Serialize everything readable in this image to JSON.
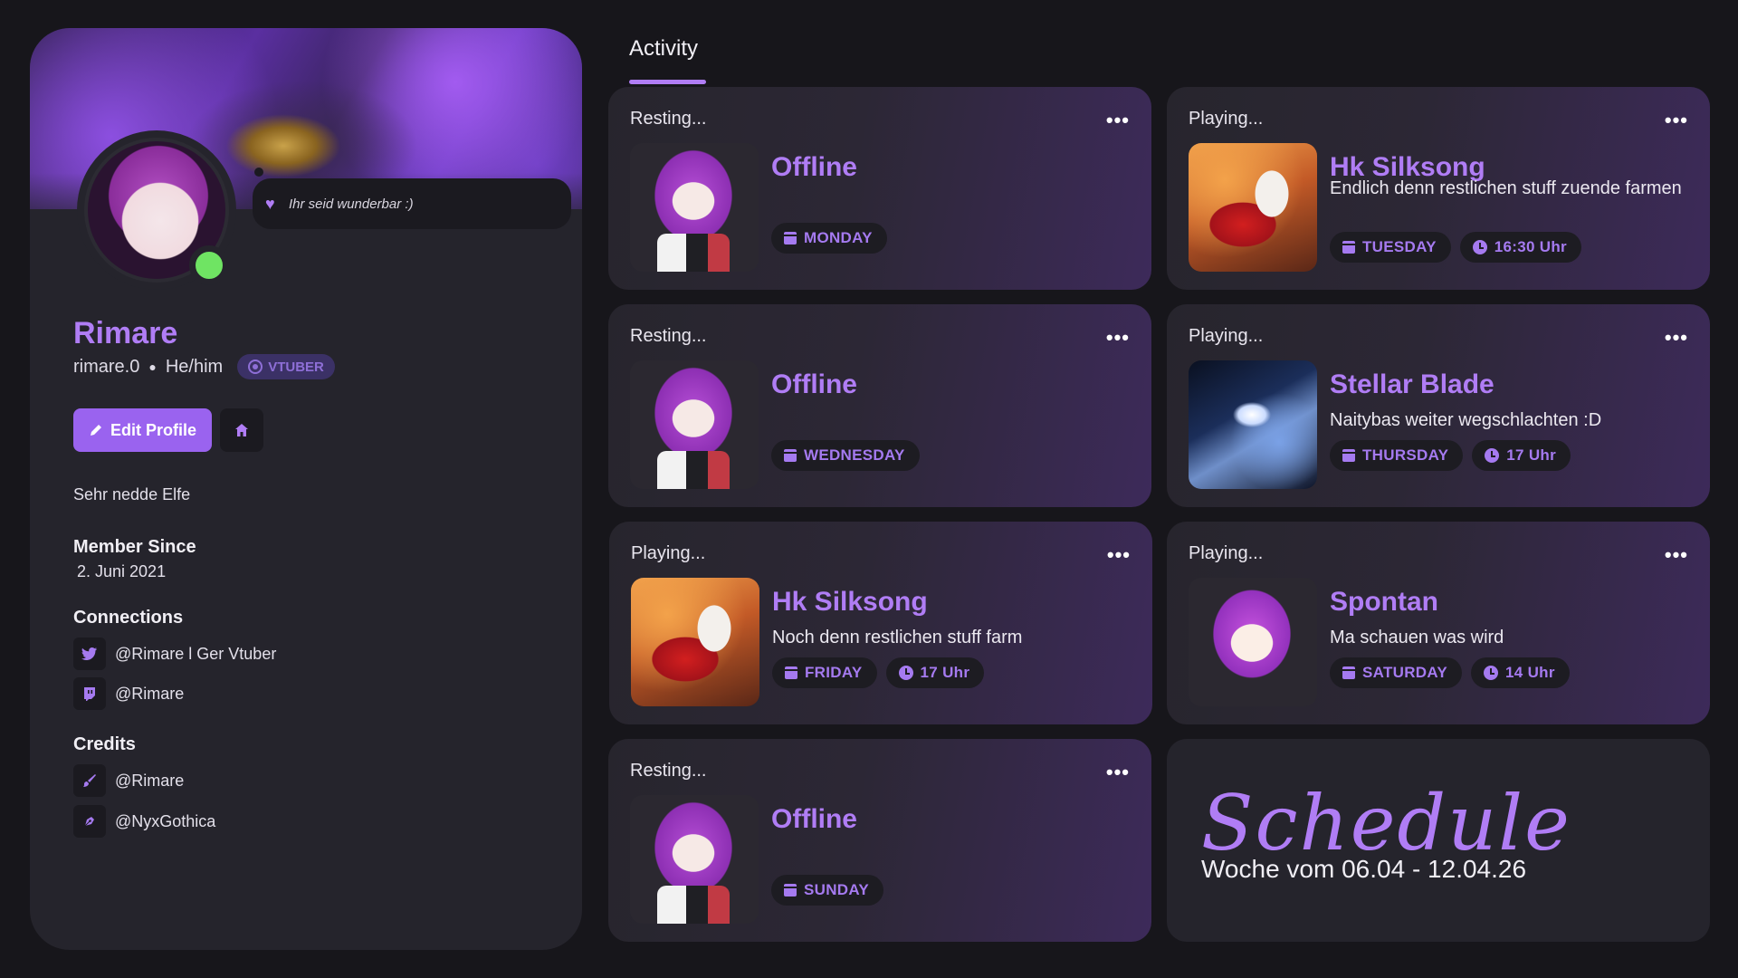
{
  "profile": {
    "status_message": "Ihr seid wunderbar :)",
    "display_name": "Rimare",
    "username": "rimare.0",
    "pronouns": "He/him",
    "badge": "VTUBER",
    "edit_label": "Edit Profile",
    "bio": "Sehr nedde Elfe",
    "member_since_title": "Member Since",
    "member_since_date": "2. Juni 2021",
    "connections_title": "Connections",
    "connections": [
      {
        "icon": "twitter-icon",
        "label": "@Rimare l Ger Vtuber"
      },
      {
        "icon": "twitch-icon",
        "label": "@Rimare"
      }
    ],
    "credits_title": "Credits",
    "credits": [
      {
        "icon": "brush-icon",
        "label": "@Rimare"
      },
      {
        "icon": "pen-icon",
        "label": "@NyxGothica"
      }
    ]
  },
  "activity_tab": "Activity",
  "cards": [
    {
      "state": "Resting...",
      "title": "Offline",
      "desc": "",
      "day": "MONDAY",
      "time": ""
    },
    {
      "state": "Playing...",
      "title": "Hk Silksong",
      "desc": "Endlich denn restlichen stuff zuende farmen",
      "day": "TUESDAY",
      "time": "16:30 Uhr"
    },
    {
      "state": "Resting...",
      "title": "Offline",
      "desc": "",
      "day": "WEDNESDAY",
      "time": ""
    },
    {
      "state": "Playing...",
      "title": "Stellar Blade",
      "desc": "Naitybas weiter wegschlachten :D",
      "day": "THURSDAY",
      "time": "17 Uhr"
    },
    {
      "state": "Playing...",
      "title": "Hk Silksong",
      "desc": "Noch denn restlichen stuff farm",
      "day": "FRIDAY",
      "time": "17 Uhr"
    },
    {
      "state": "Playing...",
      "title": "Spontan",
      "desc": "Ma schauen was wird",
      "day": "SATURDAY",
      "time": "14  Uhr"
    },
    {
      "state": "Resting...",
      "title": "Offline",
      "desc": "",
      "day": "SUNDAY",
      "time": ""
    }
  ],
  "more_label": "•••",
  "schedule": {
    "title": "Schedule",
    "subtitle": "Woche vom 06.04 - 12.04.26"
  },
  "colors": {
    "accent": "#b07df5",
    "online": "#6fe463",
    "background": "#17161b",
    "panel": "#25242c"
  }
}
